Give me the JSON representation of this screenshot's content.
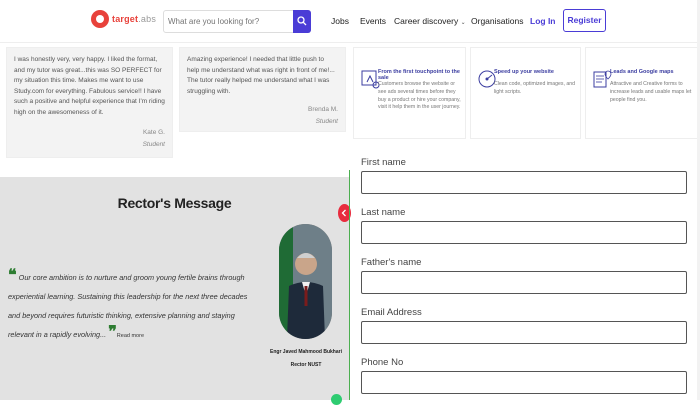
{
  "nav": {
    "logo_main": "target",
    "logo_suffix": ".abs",
    "search_placeholder": "What are you looking for?",
    "links": [
      "Jobs",
      "Events",
      "Career discovery",
      "Organisations"
    ],
    "login": "Log In",
    "register": "Register"
  },
  "testimonials": [
    {
      "text": "I was honestly very, very happy. I liked the format, and my tutor was great...this was SO PERFECT for my situation this time. Makes me want to use Study.com for everything. Fabulous service!! I have such a positive and helpful experience that I'm riding high on the awesomeness of it.",
      "name": "Kate G.",
      "role": "Student"
    },
    {
      "text": "Amazing experience! I needed that little push to help me understand what was right in front of me!... The tutor really helped me understand what I was struggling with.",
      "name": "Brenda M.",
      "role": "Student"
    }
  ],
  "features": [
    {
      "title": "From the first touchpoint to the sale",
      "desc": "Customers browse the website or see ads several times before they buy a product or hire your company, visit it help them in the user journey."
    },
    {
      "title": "Speed up your website",
      "desc": "Clean code, optimized images, and light scripts."
    },
    {
      "title": "Leads and Google maps",
      "desc": "Attractive and Creative forms to increase leads and usable maps let people find you."
    }
  ],
  "rector": {
    "title": "Rector's Message",
    "quote_line1": "Our core ambition is to nurture and groom young fertile brains through experiential learning.",
    "quote_line2": "Sustaining this leadership for the next three decades and beyond requires futuristic thinking,",
    "quote_line3": "extensive planning and staying relevant in a rapidly evolving...",
    "open_quote": "❝",
    "close_quote": "❞",
    "read_more": "Read more",
    "name": "Engr Javed Mahmood Bukhari",
    "title_role": "Rector NUST"
  },
  "form": {
    "first_name_label": "First name",
    "last_name_label": "Last name",
    "father_name_label": "Father's name",
    "email_label": "Email Address",
    "phone_label": "Phone No",
    "first_name_value": "",
    "last_name_value": "",
    "father_name_value": "",
    "email_value": "",
    "phone_value": ""
  },
  "colors": {
    "brand_red": "#e8423b",
    "accent_purple": "#4a3cd6",
    "green": "#4caf50"
  }
}
